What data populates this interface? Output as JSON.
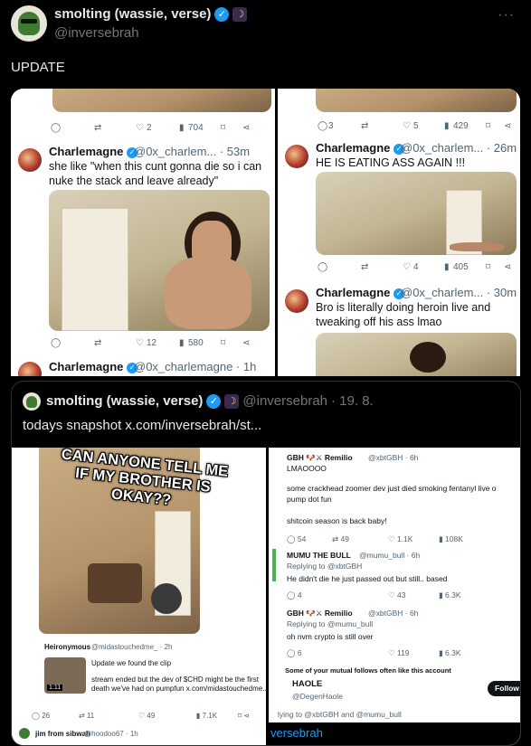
{
  "author": {
    "display_name": "smolting (wassie, verse)",
    "handle": "@inversebrah",
    "verified_icon": "check-icon",
    "badge_icon": "moon-icon"
  },
  "post": {
    "text": "UPDATE",
    "more_label": "···"
  },
  "image_top": {
    "left": {
      "action_counts": {
        "reply": "",
        "repost": "",
        "like": "2",
        "views": "704"
      },
      "tweet": {
        "name": "Charlemagne",
        "handle": "@0x_charlem...",
        "time": "· 53m",
        "text_line1": "she like \"when this cunt gonna die so i can",
        "text_line2": "nuke the stack and leave already\"",
        "action_counts": {
          "like": "12",
          "views": "580"
        }
      },
      "tweet2": {
        "name": "Charlemagne",
        "handle": "@0x_charlemagne · 1h"
      }
    },
    "right": {
      "action_counts": {
        "reply": "3",
        "like": "5",
        "views": "429"
      },
      "tweet": {
        "name": "Charlemagne",
        "handle": "@0x_charlem...",
        "time": "· 26m",
        "text": "HE IS EATING ASS AGAIN !!!",
        "action_counts": {
          "like": "4",
          "views": "405"
        }
      },
      "tweet2": {
        "name": "Charlemagne",
        "handle": "@0x_charlem...",
        "time": "· 30m",
        "text_line1": "Bro is literally doing heroin live and",
        "text_line2": "tweaking off his ass lmao"
      }
    }
  },
  "quote": {
    "display_name": "smolting (wassie, verse)",
    "handle": "@inversebrah",
    "date": "· 19. 8.",
    "text": "todays snapshot  x.com/inversebrah/st...",
    "image": {
      "left": {
        "meme_line1": "CAN ANYONE TELL ME",
        "meme_line2": "IF MY BROTHER IS",
        "meme_line3": "OKAY??",
        "card_name": "Heironymous",
        "card_handle": "@midastouchedme_ · 2h",
        "card_line1": "Update we found the clip",
        "card_line2": "stream ended but the dev of $CHD might be the first",
        "card_line3": "death we've had on pumpfun  x.com/midastouchedme...",
        "video_time": "1:11",
        "counts": {
          "reply": "26",
          "repost": "11",
          "like": "49",
          "views": "7.1K"
        },
        "bottom_name": "jim from sibwah",
        "bottom_handle": "@hoodoo67 · 1h"
      },
      "right": {
        "t1_name": "GBH 🐶⚔ Remilio",
        "t1_handle": "@xbtGBH · 6h",
        "t1_line1": "LMAOOOO",
        "t1_line2": "some crackhead zoomer dev just died smoking fentanyl live o",
        "t1_line3": "pump dot fun",
        "t1_line4": "shitcoin season is back baby!",
        "t1_counts": {
          "reply": "54",
          "repost": "49",
          "like": "1.1K",
          "views": "108K"
        },
        "t2_name": "MUMU THE BULL",
        "t2_handle": "@mumu_bull · 6h",
        "t2_reply": "Replying to @xbtGBH",
        "t2_text": "He didn't die he just passed out but still.. based",
        "t2_counts": {
          "reply": "4",
          "like": "43",
          "views": "6.3K"
        },
        "t3_name": "GBH 🐶⚔ Remilio",
        "t3_handle": "@xbtGBH · 6h",
        "t3_reply": "Replying to @mumu_bull",
        "t3_text": "oh nvm crypto is still over",
        "t3_counts": {
          "reply": "6",
          "like": "119",
          "views": "6.3K"
        },
        "follows_note": "Some of your mutual follows often like this account",
        "suggest_name": "HAOLE",
        "suggest_handle": "@DegenHaole",
        "follow_label": "Follow Bac",
        "bottom_reply": "lying to @xbtGBH and @mumu_bull",
        "bottom_handle": "versebrah"
      }
    }
  }
}
